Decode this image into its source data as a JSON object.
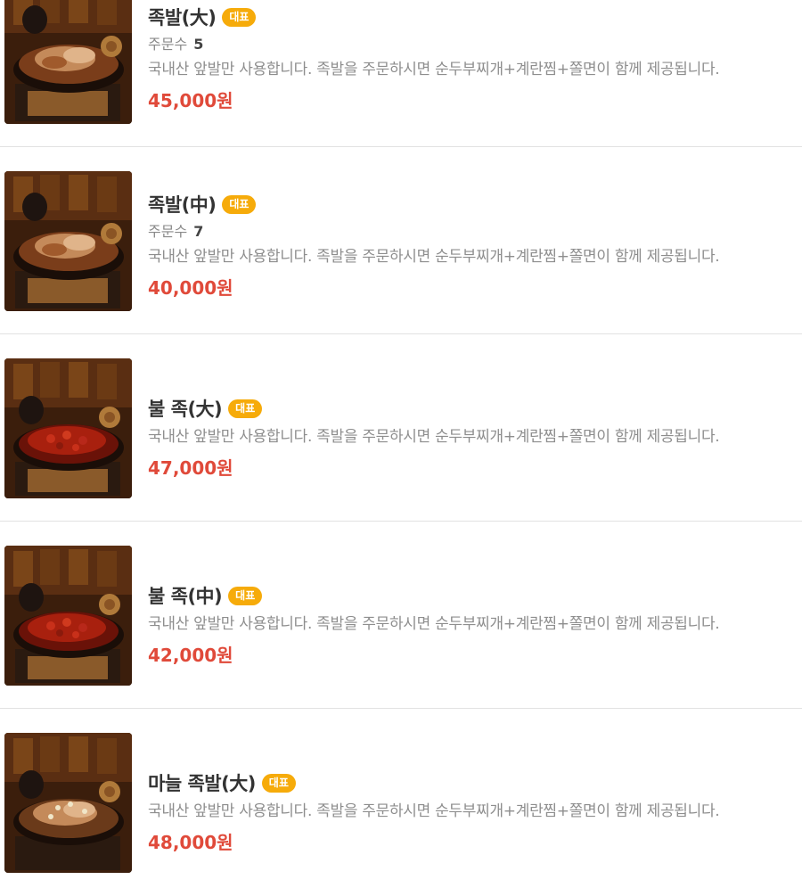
{
  "menu": {
    "items": [
      {
        "name": "족발(大)",
        "badge": "대표",
        "orders_label": "주문수",
        "orders": "5",
        "description": "국내산 앞발만 사용합니다. 족발을 주문하시면 순두부찌개+계란찜+쫄면이 함께 제공됩니다.",
        "price": "45,000원",
        "dish": "jokbal"
      },
      {
        "name": "족발(中)",
        "badge": "대표",
        "orders_label": "주문수",
        "orders": "7",
        "description": "국내산 앞발만 사용합니다. 족발을 주문하시면 순두부찌개+계란찜+쫄면이 함께 제공됩니다.",
        "price": "40,000원",
        "dish": "jokbal"
      },
      {
        "name": "불 족(大)",
        "badge": "대표",
        "description": "국내산 앞발만 사용합니다. 족발을 주문하시면 순두부찌개+계란찜+쫄면이 함께 제공됩니다.",
        "price": "47,000원",
        "dish": "spicy-jokbal"
      },
      {
        "name": "불 족(中)",
        "badge": "대표",
        "description": "국내산 앞발만 사용합니다. 족발을 주문하시면 순두부찌개+계란찜+쫄면이 함께 제공됩니다.",
        "price": "42,000원",
        "dish": "spicy-jokbal"
      },
      {
        "name": "마늘 족발(大)",
        "badge": "대표",
        "description": "국내산 앞발만 사용합니다. 족발을 주문하시면 순두부찌개+계란찜+쫄면이 함께 제공됩니다.",
        "price": "48,000원",
        "dish": "garlic-jokbal"
      }
    ]
  },
  "colors": {
    "badge": "#f6ab0a",
    "price": "#e04a3a",
    "divider": "#e2e2e2"
  }
}
